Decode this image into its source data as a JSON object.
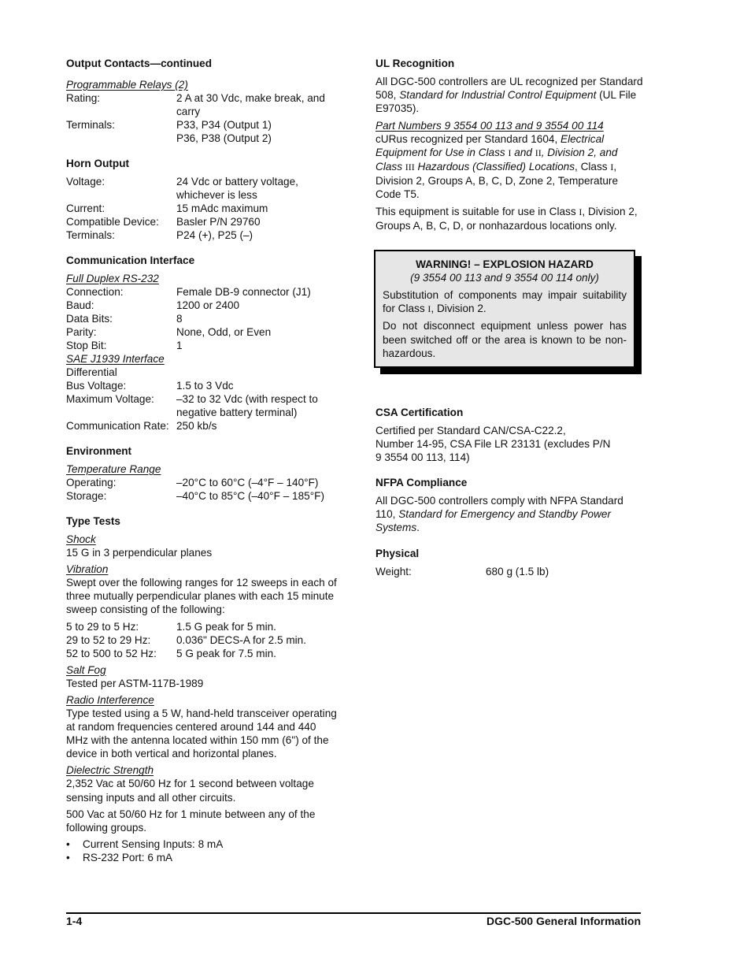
{
  "left": {
    "output_contacts": {
      "heading": "Output Contacts—continued",
      "sub": "Programmable Relays (2)",
      "rows": [
        {
          "k": "Rating:",
          "v": "2 A at 30 Vdc, make break, and carry"
        },
        {
          "k": "Terminals:",
          "v": "P33, P34 (Output 1)"
        },
        {
          "k": "",
          "v": "P36, P38 (Output 2)"
        }
      ]
    },
    "horn_output": {
      "heading": "Horn Output",
      "rows": [
        {
          "k": "Voltage:",
          "v": "24 Vdc or battery voltage, whichever is less"
        },
        {
          "k": "Current:",
          "v": "15 mAdc maximum"
        },
        {
          "k": "Compatible Device:",
          "v": "Basler P/N 29760"
        },
        {
          "k": "Terminals:",
          "v": "P24 (+), P25 (–)"
        }
      ]
    },
    "communication": {
      "heading": "Communication Interface",
      "rs232_sub": "Full Duplex RS-232",
      "rs232_rows": [
        {
          "k": "Connection:",
          "v": "Female DB-9 connector (J1)"
        },
        {
          "k": "Baud:",
          "v": "1200 or 2400"
        },
        {
          "k": "Data Bits:",
          "v": "8"
        },
        {
          "k": "Parity:",
          "v": "None, Odd, or Even"
        },
        {
          "k": "Stop Bit:",
          "v": "1"
        }
      ],
      "j1939_sub": "SAE J1939 Interface",
      "j1939_note": "Differential",
      "j1939_rows": [
        {
          "k": "Bus Voltage:",
          "v": "1.5 to 3 Vdc"
        },
        {
          "k": "Maximum Voltage:",
          "v": "–32 to 32 Vdc (with respect to negative battery terminal)"
        },
        {
          "k": "Communication Rate:",
          "v": "250 kb/s"
        }
      ]
    },
    "environment": {
      "heading": "Environment",
      "sub": "Temperature Range",
      "rows": [
        {
          "k": "Operating:",
          "v": "–20°C to 60°C (–4°F – 140°F)"
        },
        {
          "k": "Storage:",
          "v": "–40°C to 85°C (–40°F – 185°F)"
        }
      ]
    },
    "type_tests": {
      "heading": "Type Tests",
      "shock_sub": "Shock",
      "shock_text": "15 G in 3 perpendicular planes",
      "vibration_sub": "Vibration",
      "vibration_text": "Swept over the following ranges for 12 sweeps in each of three mutually perpendicular planes with each 15 minute sweep consisting of the following:",
      "vibration_rows": [
        {
          "k": "5 to 29 to 5 Hz:",
          "v": "1.5 G peak for 5 min."
        },
        {
          "k": "29 to 52 to 29 Hz:",
          "v": "0.036\" DECS-A for 2.5 min."
        },
        {
          "k": "52 to 500 to 52 Hz:",
          "v": "5 G peak for 7.5 min."
        }
      ],
      "salt_sub": "Salt Fog",
      "salt_text": "Tested per ASTM-117B-1989",
      "radio_sub": "Radio Interference",
      "radio_text": "Type tested using a 5 W, hand-held transceiver operating at random frequencies centered around 144 and 440 MHz with the antenna located within 150 mm (6\") of the device in both vertical and horizontal planes.",
      "dielectric_sub": "Dielectric Strength",
      "dielectric_p1": "2,352 Vac at 50/60 Hz for 1 second between voltage sensing inputs and all other circuits.",
      "dielectric_p2": "500 Vac at 50/60 Hz for 1 minute between any of the following groups.",
      "bullets": [
        "Current Sensing Inputs: 8 mA",
        "RS-232 Port: 6 mA"
      ]
    }
  },
  "right": {
    "ul": {
      "heading": "UL Recognition",
      "p1_a": "All DGC-500 controllers are UL recognized per Standard 508, ",
      "p1_it": "Standard for Industrial Control Equipment",
      "p1_b": " (UL File E97035).",
      "part_sub": "Part Numbers 9 3554 00 113 and 9 3554 00 114",
      "p2_a": "cURus recognized per Standard 1604, ",
      "p2_it1": "Electrical Equipment for Use in Class ",
      "p2_r1": "I",
      "p2_it2": " and ",
      "p2_r2": "II",
      "p2_it3": ", Division 2, and Class ",
      "p2_r3": "III",
      "p2_it4": " Hazardous (Classified) Locations",
      "p2_b": ", Class ",
      "p2_r4": "I",
      "p2_c": ", Division 2, Groups A, B, C, D, Zone 2, Temperature Code T5.",
      "p3_a": "This equipment is suitable for use in Class ",
      "p3_r": "I",
      "p3_b": ", Division 2, Groups A, B, C, D, or nonhazardous locations only."
    },
    "warning": {
      "title": "WARNING! – EXPLOSION HAZARD",
      "subtitle": "(9 3554 00 113 and 9 3554 00 114 only)",
      "p1_a": "Substitution of components may impair suitability for Class ",
      "p1_r": "I",
      "p1_b": ", Division 2.",
      "p2": "Do not disconnect equipment unless power has been switched off or the area is known to be non-hazardous."
    },
    "csa": {
      "heading": "CSA Certification",
      "lines": [
        "Certified per Standard CAN/CSA-C22.2,",
        "Number 14-95, CSA File LR 23131 (excludes P/N",
        "9 3554 00 113, 114)"
      ]
    },
    "nfpa": {
      "heading": "NFPA Compliance",
      "p_a": "All DGC-500 controllers comply with NFPA Standard 110, ",
      "p_it": "Standard for Emergency and Standby Power Systems",
      "p_b": "."
    },
    "physical": {
      "heading": "Physical",
      "rows": [
        {
          "k": "Weight:",
          "v": "680 g (1.5 lb)"
        }
      ]
    }
  },
  "footer": {
    "page_number": "1-4",
    "title": "DGC-500 General Information"
  }
}
